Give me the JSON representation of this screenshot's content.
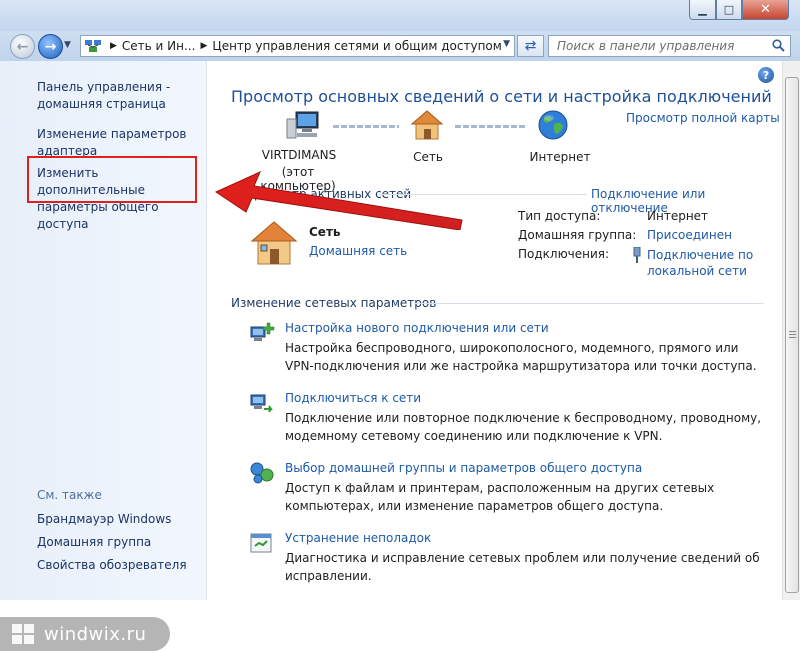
{
  "window": {
    "minimize_icon": "minimize-icon",
    "maximize_icon": "maximize-icon",
    "close_icon": "close-icon"
  },
  "nav": {
    "breadcrumb": [
      "Сеть и Ин...",
      "Центр управления сетями и общим доступом"
    ],
    "search_placeholder": "Поиск в панели управления"
  },
  "sidebar": {
    "links": [
      "Панель управления - домашняя страница",
      "Изменение параметров адаптера",
      "Изменить дополнительные параметры общего доступа"
    ],
    "see_also_title": "См. также",
    "see_also": [
      "Брандмауэр Windows",
      "Домашняя группа",
      "Свойства обозревателя"
    ],
    "watermark": "windwix.ru"
  },
  "main": {
    "title": "Просмотр основных сведений о сети и настройка подключений",
    "full_map_link": "Просмотр полной карты",
    "map": {
      "computer_name": "VIRTDIMANS",
      "computer_sub": "(этот компьютер)",
      "network": "Сеть",
      "internet": "Интернет"
    },
    "active_networks": {
      "header": "росмотр активных сетей",
      "connect_link": "Подключение или отключение",
      "network_name": "Сеть",
      "network_type": "Домашняя сеть",
      "props": [
        {
          "key": "Тип доступа:",
          "value": "Интернет"
        },
        {
          "key": "Домашняя группа:",
          "value": "Присоединен"
        },
        {
          "key": "Подключения:",
          "value": "Подключение по локальной сети"
        }
      ]
    },
    "change_settings": {
      "header": "Изменение сетевых параметров",
      "tasks": [
        {
          "title": "Настройка нового подключения или сети",
          "desc": "Настройка беспроводного, широкополосного, модемного, прямого или VPN-подключения или же настройка маршрутизатора или точки доступа."
        },
        {
          "title": "Подключиться к сети",
          "desc": "Подключение или повторное подключение к беспроводному, проводному, модемному сетевому соединению или подключение к VPN."
        },
        {
          "title": "Выбор домашней группы и параметров общего доступа",
          "desc": "Доступ к файлам и принтерам, расположенным на других сетевых компьютерах, или изменение параметров общего доступа."
        },
        {
          "title": "Устранение неполадок",
          "desc": "Диагностика и исправление сетевых проблем или получение сведений об исправлении."
        }
      ]
    }
  },
  "colors": {
    "link": "#1e5aa8",
    "title": "#1e4f98",
    "highlight": "#e0201c",
    "sidebar_bg": "#e7effa"
  }
}
